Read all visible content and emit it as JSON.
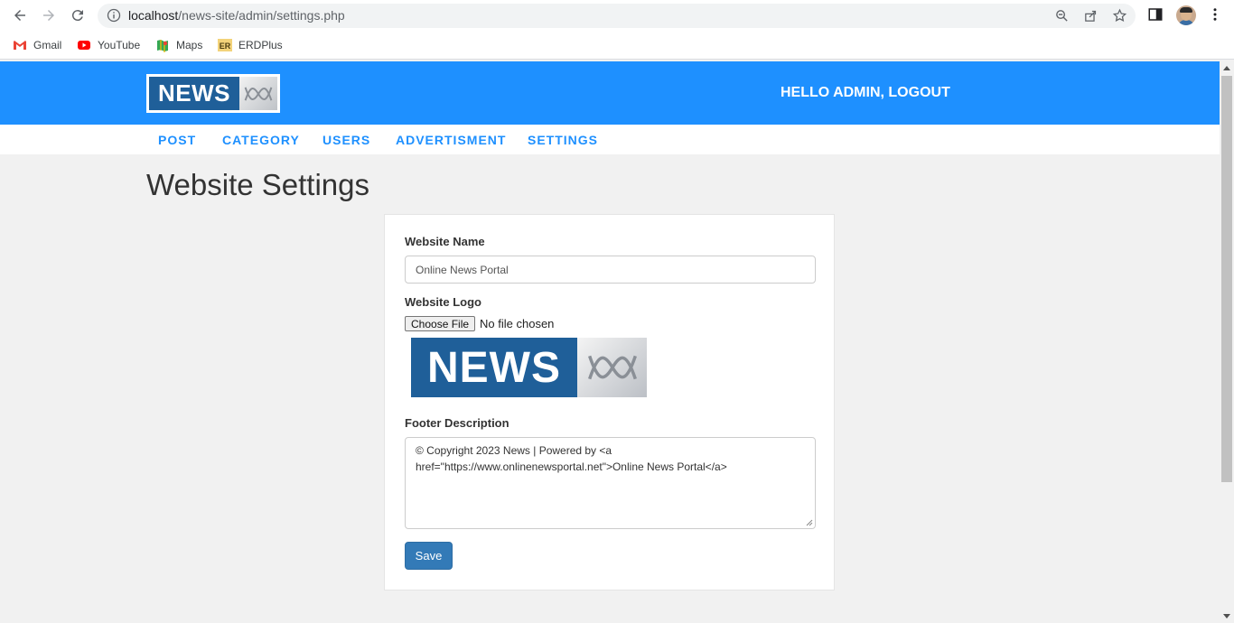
{
  "browser": {
    "url_host": "localhost",
    "url_path": "/news-site/admin/settings.php",
    "bookmarks": [
      {
        "label": "Gmail",
        "icon": "gmail-icon"
      },
      {
        "label": "YouTube",
        "icon": "youtube-icon"
      },
      {
        "label": "Maps",
        "icon": "maps-icon"
      },
      {
        "label": "ERDPlus",
        "icon": "erdplus-icon"
      }
    ]
  },
  "header": {
    "logo_text": "NEWS",
    "greeting": "HELLO ADMIN, LOGOUT",
    "brand_color": "#1e90ff"
  },
  "menu": {
    "items": [
      "POST",
      "CATEGORY",
      "USERS",
      "ADVERTISMENT",
      "SETTINGS"
    ]
  },
  "page": {
    "title": "Website Settings"
  },
  "form": {
    "website_name_label": "Website Name",
    "website_name_value": "Online News Portal",
    "website_logo_label": "Website Logo",
    "choose_file_label": "Choose File",
    "no_file_text": "No file chosen",
    "logo_preview_text": "NEWS",
    "footer_label": "Footer Description",
    "footer_value_line1": "© Copyright 2023 News | Powered by <a",
    "footer_value_line2": "href=\"https://www.onlinenewsportal.net\">Online News Portal</a>",
    "save_label": "Save",
    "save_color": "#337ab7"
  }
}
